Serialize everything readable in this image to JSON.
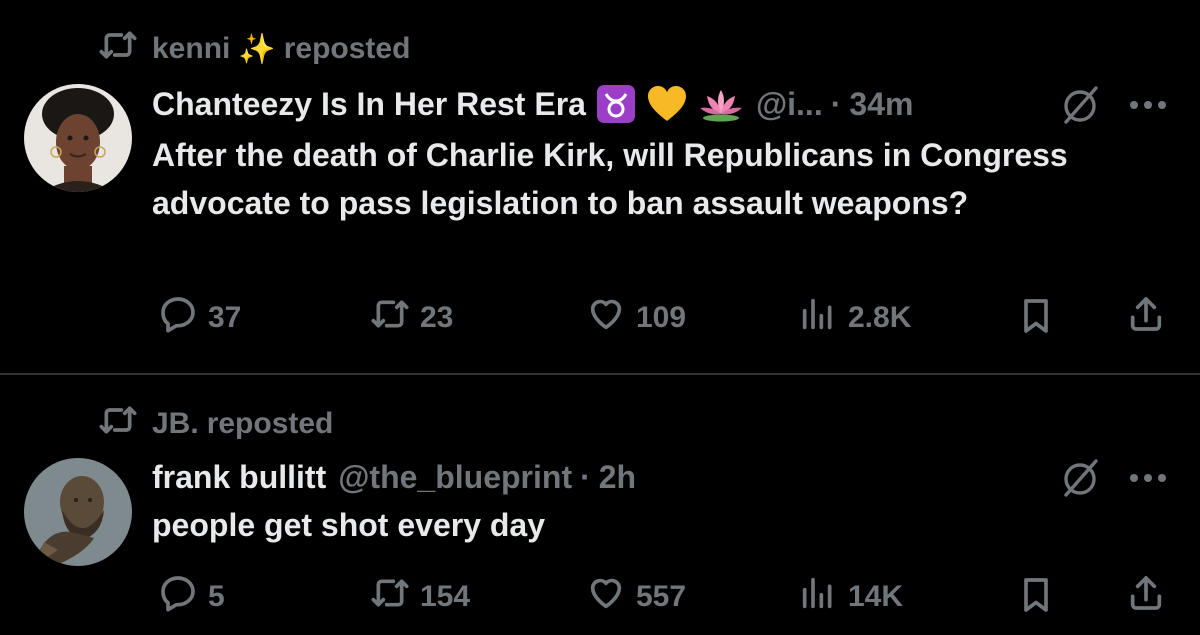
{
  "posts": [
    {
      "reposted_by": "kenni",
      "reposted_label": "reposted",
      "reposter_emoji": "✨",
      "author_name": "Chanteezy Is In Her Rest Era",
      "author_emojis": [
        "♉",
        "💛",
        "🪷"
      ],
      "handle": "@i...",
      "separator": "·",
      "time": "34m",
      "text": "After the death of Charlie Kirk, will Republicans in Congress advocate to pass legislation to ban assault weapons?",
      "replies": "37",
      "reposts": "23",
      "likes": "109",
      "views": "2.8K"
    },
    {
      "reposted_by": "JB.",
      "reposted_label": "reposted",
      "author_name": "frank bullitt",
      "handle": "@the_blueprint",
      "separator": "·",
      "time": "2h",
      "text": "people get shot every day",
      "replies": "5",
      "reposts": "154",
      "likes": "557",
      "views": "14K"
    }
  ],
  "colors": {
    "background": "#000000",
    "text_primary": "#e7e9ea",
    "text_secondary": "#71767b",
    "divider": "#2f3336"
  },
  "icons": [
    "repost-icon",
    "reply-icon",
    "like-icon",
    "views-icon",
    "bookmark-icon",
    "share-icon",
    "grok-icon",
    "more-icon"
  ]
}
